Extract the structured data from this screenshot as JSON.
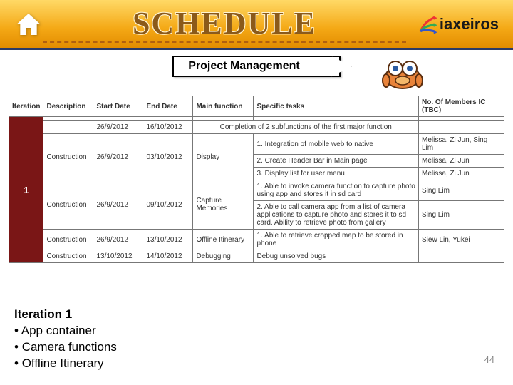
{
  "header": {
    "title": "SCHEDULE",
    "logo_text": "iaxeiros"
  },
  "subheader": {
    "project_label": "Project Management"
  },
  "table": {
    "headers": [
      "Iteration",
      "Description",
      "Start Date",
      "End Date",
      "Main function",
      "Specific tasks",
      "No. Of Members IC (TBC)"
    ],
    "iter_label": "1",
    "rows": [
      {
        "desc": "",
        "start": "26/9/2012",
        "end": "16/10/2012",
        "func": "",
        "tasks": "Completion of 2 subfunctions of the first major function",
        "ic": ""
      },
      {
        "desc": "Construction",
        "start": "26/9/2012",
        "end": "03/10/2012",
        "func": "Display",
        "tasks": "1. Integration of mobile web to native",
        "ic": "Melissa, Zi Jun, Sing Lim"
      },
      {
        "desc": "",
        "start": "",
        "end": "",
        "func": "",
        "tasks": "2. Create Header Bar in Main page",
        "ic": "Melissa, Zi Jun"
      },
      {
        "desc": "",
        "start": "",
        "end": "",
        "func": "",
        "tasks": "3. Display list for user menu",
        "ic": "Melissa, Zi Jun"
      },
      {
        "desc": "Construction",
        "start": "26/9/2012",
        "end": "09/10/2012",
        "func": "Capture Memories",
        "tasks": "1. Able to invoke camera function to capture photo using app and stores it in sd card",
        "ic": "Sing Lim"
      },
      {
        "desc": "",
        "start": "",
        "end": "",
        "func": "",
        "tasks": "2. Able to call camera app from a list of camera applications to capture photo and stores it to sd card. Ability to retrieve photo from gallery",
        "ic": "Sing Lim"
      },
      {
        "desc": "Construction",
        "start": "26/9/2012",
        "end": "13/10/2012",
        "func": "Offline Itinerary",
        "tasks": "1. Able to retrieve cropped map to be stored in phone",
        "ic": "Siew Lin, Yukei"
      },
      {
        "desc": "Construction",
        "start": "13/10/2012",
        "end": "14/10/2012",
        "func": "Debugging",
        "tasks": "Debug unsolved bugs",
        "ic": ""
      }
    ]
  },
  "notes": {
    "heading": "Iteration 1",
    "bullets": [
      "App container",
      "Camera functions",
      "Offline Itinerary"
    ]
  },
  "page_number": "44",
  "chart_data": {
    "type": "table",
    "title": "Schedule — Project Management — Iteration 1",
    "columns": [
      "Iteration",
      "Description",
      "Start Date",
      "End Date",
      "Main function",
      "Specific tasks",
      "No. Of Members IC (TBC)"
    ],
    "rows": [
      [
        "1",
        "",
        "26/9/2012",
        "16/10/2012",
        "",
        "Completion of 2 subfunctions of the first major function",
        ""
      ],
      [
        "1",
        "Construction",
        "26/9/2012",
        "03/10/2012",
        "Display",
        "1. Integration of mobile web to native",
        "Melissa, Zi Jun, Sing Lim"
      ],
      [
        "1",
        "",
        "",
        "",
        "Display",
        "2. Create Header Bar in Main page",
        "Melissa, Zi Jun"
      ],
      [
        "1",
        "",
        "",
        "",
        "Display",
        "3. Display list for user menu",
        "Melissa, Zi Jun"
      ],
      [
        "1",
        "Construction",
        "26/9/2012",
        "09/10/2012",
        "Capture Memories",
        "1. Able to invoke camera function to capture photo using app and stores it in sd card",
        "Sing Lim"
      ],
      [
        "1",
        "",
        "",
        "",
        "Capture Memories",
        "2. Able to call camera app from a list of camera applications to capture photo and stores it to sd card. Ability to retrieve photo from gallery",
        "Sing Lim"
      ],
      [
        "1",
        "Construction",
        "26/9/2012",
        "13/10/2012",
        "Offline Itinerary",
        "1. Able to retrieve cropped map to be stored in phone",
        "Siew Lin, Yukei"
      ],
      [
        "1",
        "Construction",
        "13/10/2012",
        "14/10/2012",
        "Debugging",
        "Debug unsolved bugs",
        ""
      ]
    ]
  }
}
